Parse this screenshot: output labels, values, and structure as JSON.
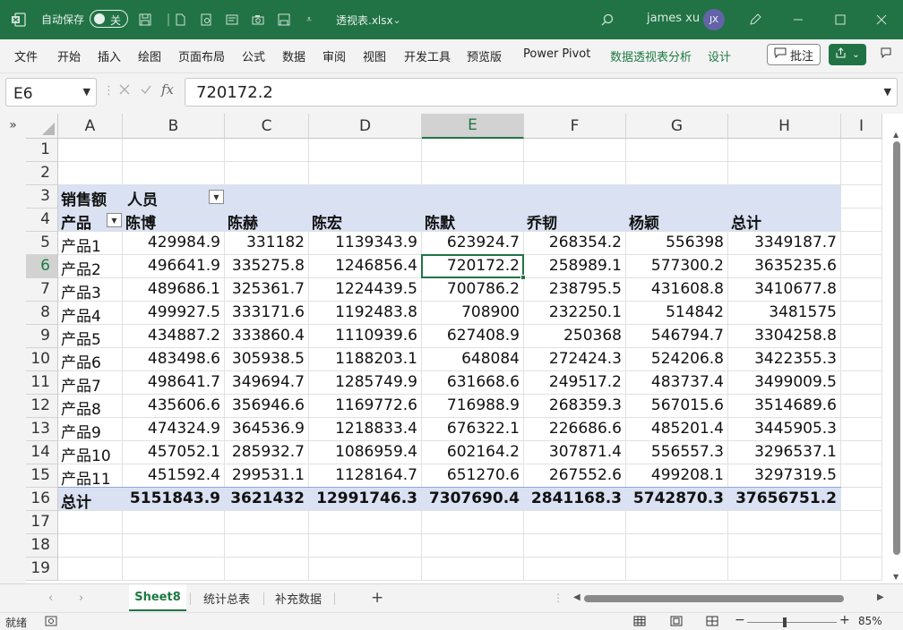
{
  "titlebar": {
    "autosave_label": "自动保存",
    "autosave_state": "关",
    "filename": "透视表.xlsx",
    "username": "james xu",
    "avatar_initials": "JX",
    "icons": [
      "excel-logo-icon",
      "save-icon",
      "file-icon",
      "print-preview-icon",
      "form-icon",
      "camera-icon",
      "save-as-icon",
      "customize-icon",
      "search-icon",
      "pen-icon",
      "minimize-icon",
      "maximize-icon",
      "close-icon"
    ]
  },
  "ribbon": {
    "menus": [
      "文件",
      "开始",
      "插入",
      "绘图",
      "页面布局",
      "公式",
      "数据",
      "审阅",
      "视图",
      "开发工具",
      "预览版",
      "Power Pivot",
      "数据透视表分析",
      "设计"
    ],
    "comment_label": "批注"
  },
  "formula_bar": {
    "name_box": "E6",
    "formula": "720172.2",
    "fx": "fx"
  },
  "sheet": {
    "columns": [
      "A",
      "B",
      "C",
      "D",
      "E",
      "F",
      "G",
      "H",
      "I"
    ],
    "selected_column": "E",
    "rows": [
      "1",
      "2",
      "3",
      "4",
      "5",
      "6",
      "7",
      "8",
      "9",
      "10",
      "11",
      "12",
      "13",
      "14",
      "15",
      "16",
      "17",
      "18",
      "19"
    ],
    "selected_row": "6",
    "pivot": {
      "value_label": "销售额",
      "col_field": "人员",
      "row_field": "产品",
      "people": [
        "陈博",
        "陈赫",
        "陈宏",
        "陈默",
        "乔韧",
        "杨颖"
      ],
      "total_label": "总计",
      "products": [
        "产品1",
        "产品2",
        "产品3",
        "产品4",
        "产品5",
        "产品6",
        "产品7",
        "产品8",
        "产品9",
        "产品10",
        "产品11"
      ],
      "values": [
        [
          "429984.9",
          "331182",
          "1139343.9",
          "623924.7",
          "268354.2",
          "556398",
          "3349187.7"
        ],
        [
          "496641.9",
          "335275.8",
          "1246856.4",
          "720172.2",
          "258989.1",
          "577300.2",
          "3635235.6"
        ],
        [
          "489686.1",
          "325361.7",
          "1224439.5",
          "700786.2",
          "238795.5",
          "431608.8",
          "3410677.8"
        ],
        [
          "499927.5",
          "333171.6",
          "1192483.8",
          "708900",
          "232250.1",
          "514842",
          "3481575"
        ],
        [
          "434887.2",
          "333860.4",
          "1110939.6",
          "627408.9",
          "250368",
          "546794.7",
          "3304258.8"
        ],
        [
          "483498.6",
          "305938.5",
          "1188203.1",
          "648084",
          "272424.3",
          "524206.8",
          "3422355.3"
        ],
        [
          "498641.7",
          "349694.7",
          "1285749.9",
          "631668.6",
          "249517.2",
          "483737.4",
          "3499009.5"
        ],
        [
          "435606.6",
          "356946.6",
          "1169772.6",
          "716988.9",
          "268359.3",
          "567015.6",
          "3514689.6"
        ],
        [
          "474324.9",
          "364536.9",
          "1218833.4",
          "676322.1",
          "226686.6",
          "485201.4",
          "3445905.3"
        ],
        [
          "457052.1",
          "285932.7",
          "1086959.4",
          "602164.2",
          "307871.4",
          "556557.3",
          "3296537.1"
        ],
        [
          "451592.4",
          "299531.1",
          "1128164.7",
          "651270.6",
          "267552.6",
          "499208.1",
          "3297319.5"
        ]
      ],
      "totals": [
        "5151843.9",
        "3621432",
        "12991746.3",
        "7307690.4",
        "2841168.3",
        "5742870.3",
        "37656751.2"
      ]
    }
  },
  "tabs": {
    "sheets": [
      "Sheet8",
      "统计总表",
      "补充数据"
    ],
    "active": "Sheet8",
    "add": "+"
  },
  "status": {
    "ready": "就绪",
    "zoom": "85%"
  },
  "colors": {
    "accent": "#217346",
    "pivot_band": "#d9e1f2"
  }
}
